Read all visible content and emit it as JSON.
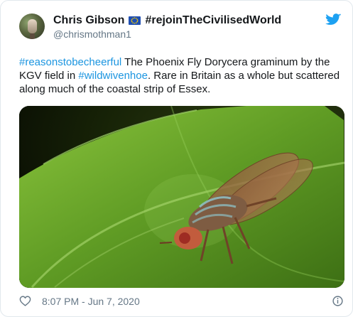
{
  "author": {
    "name": "Chris Gibson",
    "name_hashtag": "#rejoinTheCivilisedWorld",
    "handle": "@chrismothman1",
    "flag_icon": "eu-flag-icon"
  },
  "tweet": {
    "hashtag_1": "#reasonstobecheerful",
    "text_1": " The Phoenix Fly Dorycera graminum by the KGV field in ",
    "hashtag_2": "#wildwivenhoe",
    "text_2": ". Rare in Britain as a whole but scattered along much of the coastal strip of Essex."
  },
  "media": {
    "icon": "fly-on-leaf-photo"
  },
  "footer": {
    "time": "8:07 PM - Jun 7, 2020"
  },
  "colors": {
    "link": "#1b95e0",
    "brand": "#1da1f2",
    "muted": "#657786"
  }
}
